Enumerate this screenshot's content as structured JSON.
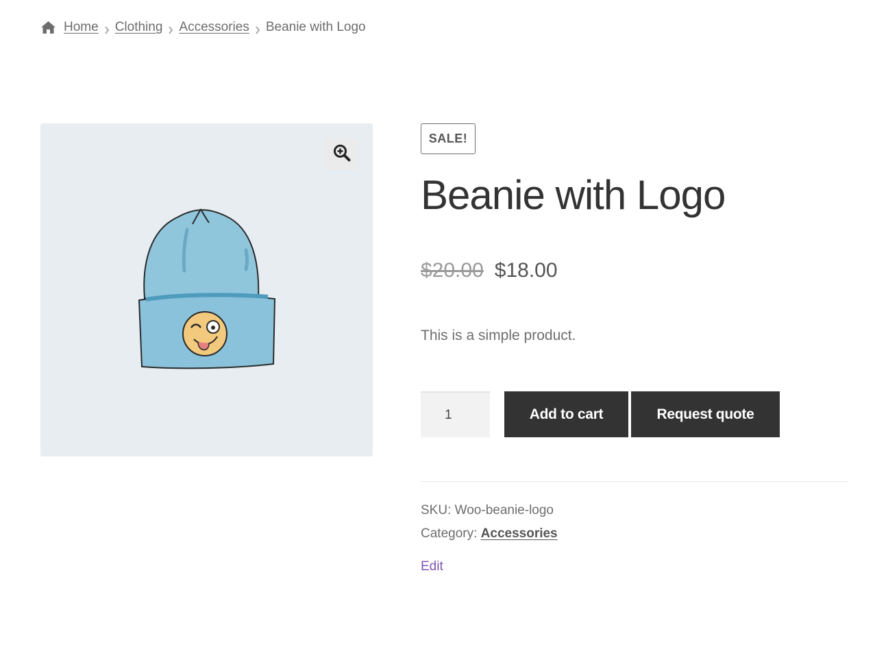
{
  "breadcrumb": {
    "home_icon": "home-icon",
    "items": [
      "Home",
      "Clothing",
      "Accessories"
    ],
    "current": "Beanie with Logo"
  },
  "gallery": {
    "zoom_icon": "zoom-in-icon",
    "image": "beanie-with-logo-illustration"
  },
  "product": {
    "badge": "SALE!",
    "title": "Beanie with Logo",
    "price_old": "$20.00",
    "price_new": "$18.00",
    "short_description": "This is a simple product.",
    "quantity": "1",
    "add_to_cart_label": "Add to cart",
    "request_quote_label": "Request quote",
    "sku_label": "SKU:",
    "sku_value": "Woo-beanie-logo",
    "category_label": "Category:",
    "category_value": "Accessories",
    "edit_label": "Edit"
  },
  "colors": {
    "button_bg": "#333333",
    "image_bg": "#e7edf1",
    "edit_link": "#7f54b3",
    "text": "#6d6d6d"
  }
}
